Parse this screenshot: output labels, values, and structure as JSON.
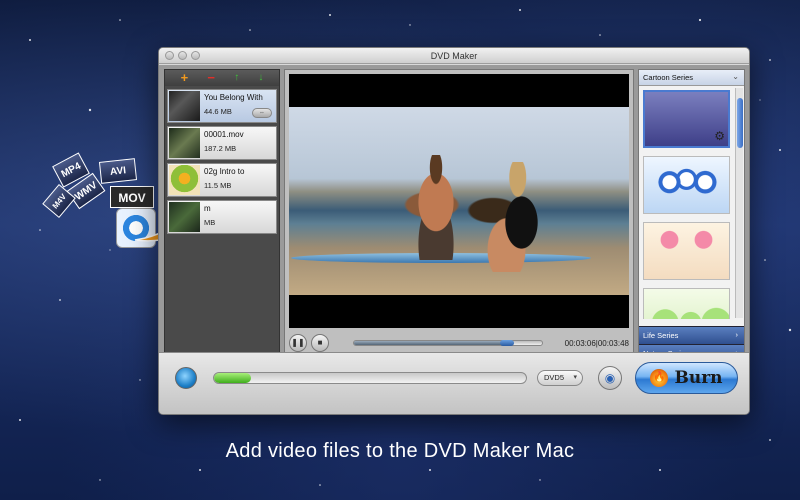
{
  "window": {
    "title": "DVD Maker"
  },
  "file_list": {
    "toolbar": [
      "+",
      "−",
      "↑",
      "↓"
    ],
    "items": [
      {
        "name": "You Belong With",
        "size": "44.6 MB",
        "selected": true
      },
      {
        "name": "00001.mov",
        "size": "187.2 MB",
        "selected": false
      },
      {
        "name": "02g Intro to",
        "size": "11.5 MB",
        "selected": false
      },
      {
        "name": "m",
        "size": "MB",
        "selected": false
      }
    ]
  },
  "player": {
    "pause_label": "❚❚",
    "stop_label": "■",
    "progress": 0.85,
    "time": "00:03:06|00:03:48"
  },
  "templates": {
    "header": "Cartoon Series",
    "series": [
      "Life Series",
      "Nature Series"
    ]
  },
  "bottom": {
    "burn_progress": 0.12,
    "disc": "DVD5",
    "burn_label": "Burn"
  },
  "formats": [
    "MP4",
    "WMV",
    "AVI",
    "M4V",
    "MOV"
  ],
  "caption": "Add video files to the DVD Maker Mac"
}
